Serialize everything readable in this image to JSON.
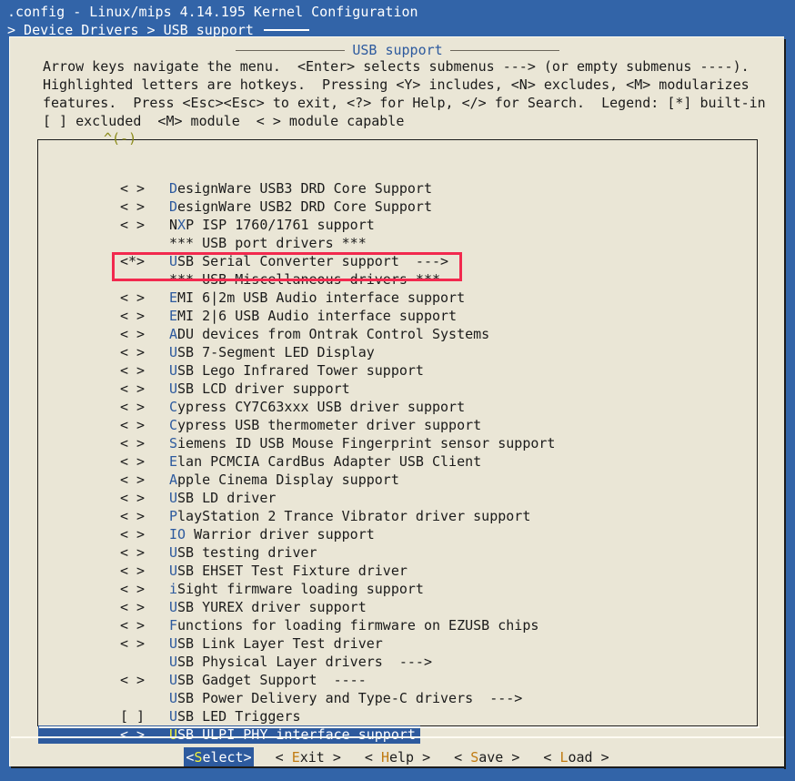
{
  "window": {
    "title": ".config - Linux/mips 4.14.195 Kernel Configuration",
    "breadcrumb": "> Device Drivers > USB support"
  },
  "dialog": {
    "title": "USB support",
    "help_lines": [
      "Arrow keys navigate the menu.  <Enter> selects submenus ---> (or empty submenus ----).",
      "Highlighted letters are hotkeys.  Pressing <Y> includes, <N> excludes, <M> modularizes",
      "features.  Press <Esc><Esc> to exit, <?> for Help, </> for Search.  Legend: [*] built-in",
      "[ ] excluded  <M> module  < > module capable"
    ],
    "scroll_indicator": "^(-)"
  },
  "menu": {
    "items": [
      {
        "mark": "< >",
        "hot": "D",
        "rest": "esignWare USB3 DRD Core Support",
        "type": "option"
      },
      {
        "mark": "< >",
        "hot": "D",
        "rest": "esignWare USB2 DRD Core Support",
        "type": "option"
      },
      {
        "mark": "< >",
        "hot": "",
        "pre": "N",
        "hot2": "X",
        "rest": "P ISP 1760/1761 support",
        "type": "option-mid"
      },
      {
        "mark": "   ",
        "hot": "",
        "rest": "*** USB port drivers ***",
        "type": "comment"
      },
      {
        "mark": "<*>",
        "hot": "U",
        "rest": "SB Serial Converter support  --->",
        "type": "option"
      },
      {
        "mark": "   ",
        "hot": "",
        "rest": "*** USB Miscellaneous drivers ***",
        "type": "comment"
      },
      {
        "mark": "< >",
        "hot": "E",
        "rest": "MI 6|2m USB Audio interface support",
        "type": "option"
      },
      {
        "mark": "< >",
        "hot": "E",
        "rest": "MI 2|6 USB Audio interface support",
        "type": "option"
      },
      {
        "mark": "< >",
        "hot": "A",
        "rest": "DU devices from Ontrak Control Systems",
        "type": "option"
      },
      {
        "mark": "< >",
        "hot": "U",
        "rest": "SB 7-Segment LED Display",
        "type": "option"
      },
      {
        "mark": "< >",
        "hot": "U",
        "rest": "SB Lego Infrared Tower support",
        "type": "option"
      },
      {
        "mark": "< >",
        "hot": "U",
        "rest": "SB LCD driver support",
        "type": "option"
      },
      {
        "mark": "< >",
        "hot": "C",
        "rest": "ypress CY7C63xxx USB driver support",
        "type": "option"
      },
      {
        "mark": "< >",
        "hot": "C",
        "rest": "ypress USB thermometer driver support",
        "type": "option"
      },
      {
        "mark": "< >",
        "hot": "S",
        "rest": "iemens ID USB Mouse Fingerprint sensor support",
        "type": "option"
      },
      {
        "mark": "< >",
        "hot": "E",
        "rest": "lan PCMCIA CardBus Adapter USB Client",
        "type": "option"
      },
      {
        "mark": "< >",
        "hot": "A",
        "rest": "pple Cinema Display support",
        "type": "option"
      },
      {
        "mark": "< >",
        "hot": "U",
        "rest": "SB LD driver",
        "type": "option"
      },
      {
        "mark": "< >",
        "hot": "P",
        "rest": "layStation 2 Trance Vibrator driver support",
        "type": "option"
      },
      {
        "mark": "< >",
        "hot": "IO",
        "rest": " Warrior driver support",
        "type": "option"
      },
      {
        "mark": "< >",
        "hot": "U",
        "rest": "SB testing driver",
        "type": "option"
      },
      {
        "mark": "< >",
        "hot": "U",
        "rest": "SB EHSET Test Fixture driver",
        "type": "option"
      },
      {
        "mark": "< >",
        "hot": "i",
        "rest": "Sight firmware loading support",
        "type": "option"
      },
      {
        "mark": "< >",
        "hot": "U",
        "rest": "SB YUREX driver support",
        "type": "option"
      },
      {
        "mark": "< >",
        "hot": "F",
        "rest": "unctions for loading firmware on EZUSB chips",
        "type": "option"
      },
      {
        "mark": "< >",
        "hot": "U",
        "rest": "SB Link Layer Test driver",
        "type": "option"
      },
      {
        "mark": "   ",
        "hot": "U",
        "rest": "SB Physical Layer drivers  --->",
        "type": "submenu"
      },
      {
        "mark": "< >",
        "hot": "U",
        "rest": "SB Gadget Support  ----",
        "type": "option"
      },
      {
        "mark": "   ",
        "hot": "U",
        "rest": "SB Power Delivery and Type-C drivers  --->",
        "type": "submenu"
      },
      {
        "mark": "[ ]",
        "hot": "U",
        "rest": "SB LED Triggers",
        "type": "option"
      },
      {
        "mark": "< >",
        "hot": "U",
        "rest": "SB ULPI PHY interface support",
        "type": "option",
        "selected": true
      }
    ]
  },
  "buttons": [
    {
      "left": "<",
      "hot": "S",
      "rest": "elect>",
      "active": true
    },
    {
      "left": "< ",
      "hot": "E",
      "rest": "xit >",
      "active": false
    },
    {
      "left": "< ",
      "hot": "H",
      "rest": "elp >",
      "active": false
    },
    {
      "left": "< ",
      "hot": "S",
      "rest": "ave >",
      "active": false
    },
    {
      "left": "< ",
      "hot": "L",
      "rest": "oad >",
      "active": false
    }
  ],
  "annotation": {
    "color": "#f2294e",
    "target": "USB Serial Converter support"
  }
}
